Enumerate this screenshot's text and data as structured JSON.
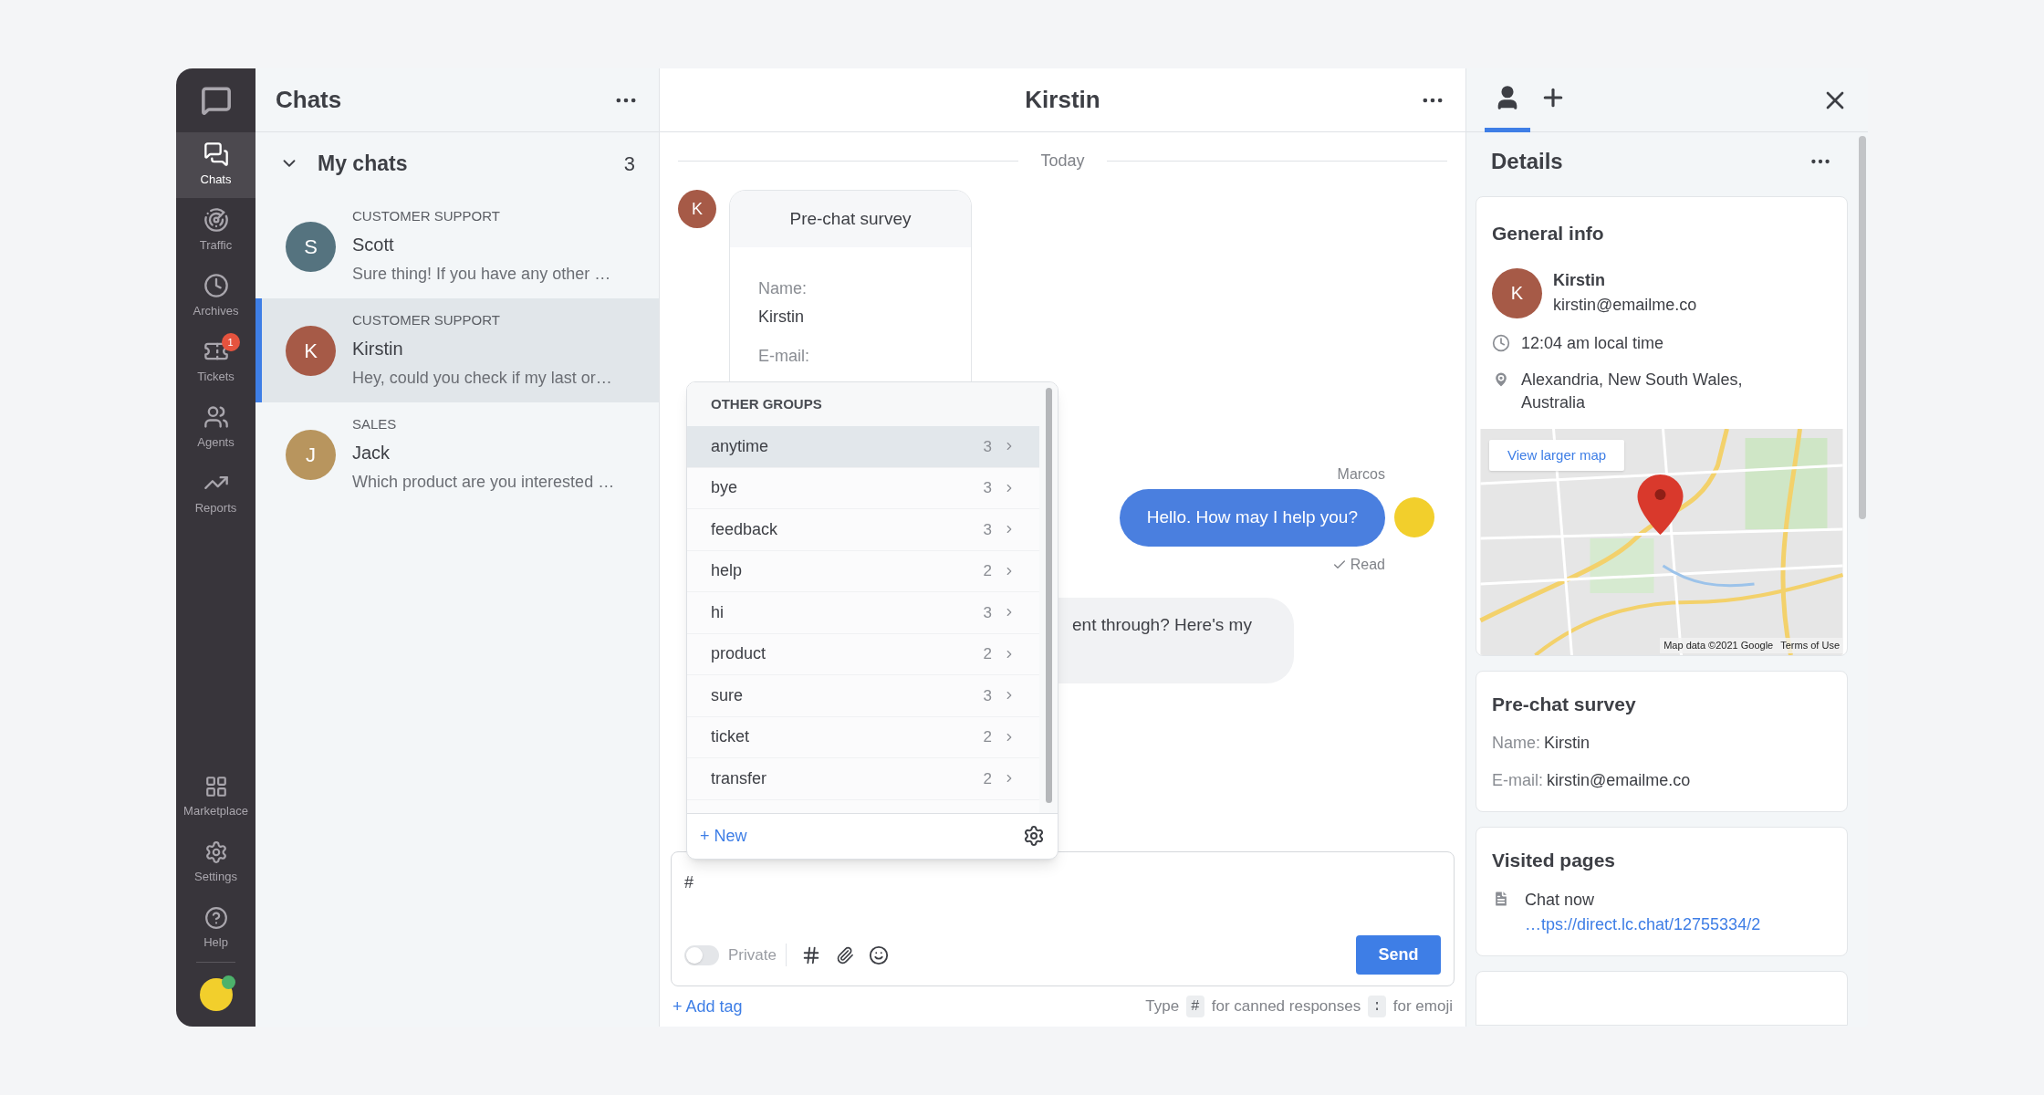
{
  "nav": {
    "items": [
      {
        "label": "Chats",
        "selected": true
      },
      {
        "label": "Traffic",
        "selected": false
      },
      {
        "label": "Archives",
        "selected": false
      },
      {
        "label": "Tickets",
        "selected": false,
        "badge": "1"
      },
      {
        "label": "Agents",
        "selected": false
      },
      {
        "label": "Reports",
        "selected": false
      }
    ],
    "bottom_items": [
      {
        "label": "Marketplace"
      },
      {
        "label": "Settings"
      },
      {
        "label": "Help"
      }
    ],
    "user": {
      "online": true
    }
  },
  "chat_list": {
    "title": "Chats",
    "group": {
      "label": "My chats",
      "count": "3",
      "expanded": true
    },
    "chats": [
      {
        "group": "CUSTOMER SUPPORT",
        "name": "Scott",
        "initial": "S",
        "color": "#55737f",
        "preview": "Sure thing! If you have any other …",
        "selected": false
      },
      {
        "group": "CUSTOMER SUPPORT",
        "name": "Kirstin",
        "initial": "K",
        "color": "#a65a47",
        "preview": "Hey, could you check if my last or…",
        "selected": true
      },
      {
        "group": "SALES",
        "name": "Jack",
        "initial": "J",
        "color": "#b8955e",
        "preview": "Which product are you interested …",
        "selected": false
      }
    ]
  },
  "chat": {
    "title": "Kirstin",
    "day": "Today",
    "survey": {
      "initial": "K",
      "title": "Pre-chat survey",
      "fields": [
        {
          "label": "Name:",
          "value": "Kirstin"
        },
        {
          "label": "E-mail:"
        }
      ]
    },
    "agent_message": {
      "author": "Marcos",
      "text": "Hello. How may I help you?",
      "status": "Read"
    },
    "customer_message": {
      "text": "ent through? Here's my"
    },
    "canned_popup": {
      "heading": "OTHER GROUPS",
      "new_label": "+ New",
      "items": [
        {
          "label": "anytime",
          "count": "3",
          "selected": true
        },
        {
          "label": "bye",
          "count": "3",
          "selected": false
        },
        {
          "label": "feedback",
          "count": "3",
          "selected": false
        },
        {
          "label": "help",
          "count": "2",
          "selected": false
        },
        {
          "label": "hi",
          "count": "3",
          "selected": false
        },
        {
          "label": "product",
          "count": "2",
          "selected": false
        },
        {
          "label": "sure",
          "count": "3",
          "selected": false
        },
        {
          "label": "ticket",
          "count": "2",
          "selected": false
        },
        {
          "label": "transfer",
          "count": "2",
          "selected": false
        }
      ]
    },
    "composer": {
      "value": "#",
      "private": {
        "label": "Private",
        "on": false
      },
      "send": "Send"
    },
    "add_tag": "+ Add tag",
    "hint": [
      {
        "kind": "text",
        "text": "Type"
      },
      {
        "kind": "key",
        "text": "#"
      },
      {
        "kind": "text",
        "text": "for canned responses"
      },
      {
        "kind": "key",
        "text": ":"
      },
      {
        "kind": "text",
        "text": "for emoji"
      }
    ]
  },
  "details": {
    "tabs": [
      {
        "selected": true
      },
      {
        "selected": false
      }
    ],
    "title": "Details",
    "general": {
      "title": "General info",
      "initial": "K",
      "name": "Kirstin",
      "email": "kirstin@emailme.co",
      "time": "12:04 am local time",
      "location": "Alexandria, New South Wales, Australia",
      "map": {
        "link": "View larger map",
        "attribution": "Map data ©2021 Google",
        "terms": "Terms of Use"
      }
    },
    "survey": {
      "title": "Pre-chat survey",
      "fields": [
        {
          "label": "Name:",
          "value": "Kirstin"
        },
        {
          "label": "E-mail:",
          "value": "kirstin@emailme.co"
        }
      ]
    },
    "visited": {
      "title": "Visited pages",
      "pages": [
        {
          "title": "Chat now",
          "url": "…tps://direct.lc.chat/12755334/2"
        }
      ]
    }
  }
}
